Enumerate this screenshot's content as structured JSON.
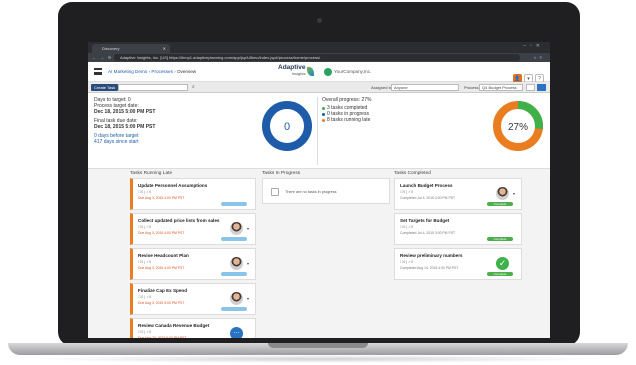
{
  "browser": {
    "tab_title": "Discovery",
    "url": "Adaptive Insights, Inc. [US]  https://lhmp1.adaptiveplanning.com/app/jsp/Ultimo/index.jsp#/process/home/process/"
  },
  "header": {
    "breadcrumb_link": "AI Marketing Demo",
    "breadcrumb_sep1": " › ",
    "breadcrumb_mid": "Processes",
    "breadcrumb_sep2": " › ",
    "breadcrumb_current": "Overview",
    "logo_main": "Adaptive",
    "logo_sub": "Insights",
    "company": "YourCompany,Inc."
  },
  "toolbar": {
    "create_label": "Create Task",
    "assigned_label": "Assigned to:",
    "assigned_value": "Anyone",
    "process_label": "Process:",
    "process_value": "Q4 Budget Process"
  },
  "summary": {
    "days_to_target": "Days to target: 0",
    "process_target_label": "Process target date:",
    "process_target_value": "Dec 18, 2015 5:00 PM PST",
    "final_due_label": "Final task due date:",
    "final_due_value": "Dec 18, 2015 5:00 PM PST",
    "days_before": "0 days before target",
    "days_since": "417 days since start",
    "left_ring_value": "0",
    "overall_progress": "Overall progress: 27%",
    "completed": "3 tasks completed",
    "in_progress": "0 tasks in progress",
    "running_late": "8 tasks running late",
    "right_ring_value": "27%",
    "progress_fraction": 0.27
  },
  "colors": {
    "late": "#ea7d1f",
    "completed": "#3eb14a",
    "in_progress": "#1e5ba8",
    "ring_blue": "#1e5ba8",
    "ring_orange": "#ea7d1f",
    "ring_green": "#3eb14a"
  },
  "columns": {
    "late_title": "Tasks Running Late",
    "progress_title": "Tasks In Progress",
    "completed_title": "Tasks Completed",
    "empty_text": "There are no tasks in progress"
  },
  "late_tasks": [
    {
      "title": "Update Personnel Assumptions",
      "meta": "☐0  |  ✓0",
      "due": "Due Aug 3, 2015 4:00 PM PST",
      "avatar": "none"
    },
    {
      "title": "Collect updated price lists from sales",
      "meta": "☐0  |  ✓0",
      "due": "Due Aug 3, 2015 4:00 PM PST",
      "avatar": "person"
    },
    {
      "title": "Revise Headcount Plan",
      "meta": "☐0  |  ✓0",
      "due": "Due Aug 3, 2015 4:00 PM PST",
      "avatar": "person"
    },
    {
      "title": "Finalize Cap Ex Spend",
      "meta": "☐0  |  ✓0",
      "due": "Due Aug 3, 2015 5:00 PM PST",
      "avatar": "person"
    },
    {
      "title": "Review Canada Revenue Budget",
      "meta": "☐0  |  ✓0",
      "due": "Due Nov 23, 2015 5:00 PM PST",
      "avatar": "dots"
    }
  ],
  "completed_tasks": [
    {
      "title": "Launch Budget Process",
      "meta": "☐0  |  ✓0",
      "due": "Completed Jul 4, 2015 3:00 PM PST",
      "badge": "Complete",
      "avatar": "person"
    },
    {
      "title": "Set Targets for Budget",
      "meta": "☐0  |  ✓0",
      "due": "Completed Jul 4, 2015 3:00 PM PST",
      "badge": "Complete",
      "avatar": "none"
    },
    {
      "title": "Review preliminary numbers",
      "meta": "☐0  |  ✓0",
      "due": "Completed Aug 14, 2015 4:00 PM PST",
      "badge": "Complete",
      "avatar": "check"
    }
  ]
}
